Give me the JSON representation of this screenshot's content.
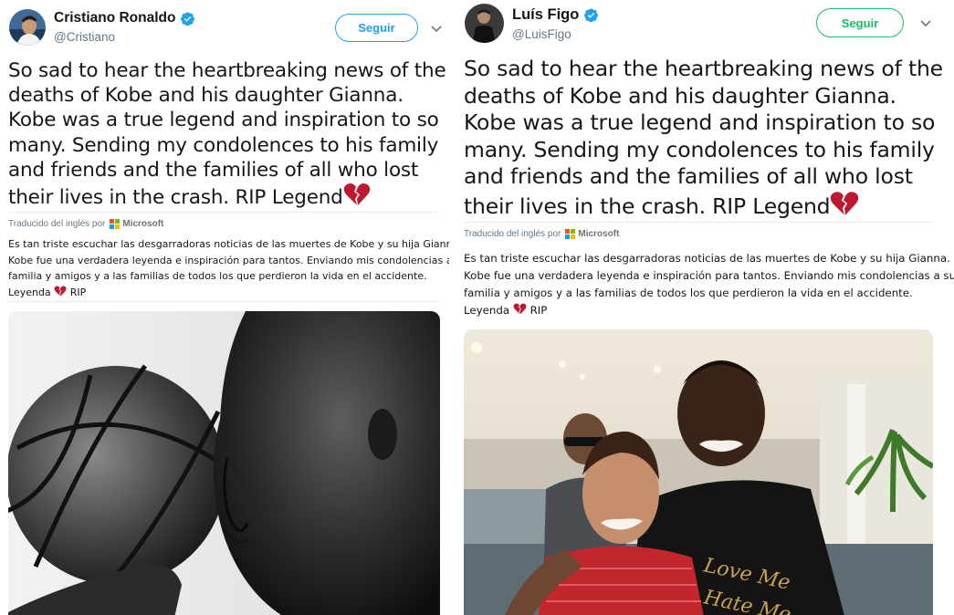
{
  "left_tweet": {
    "name": "Cristiano Ronaldo",
    "handle": "@Cristiano",
    "follow_label": "Seguir",
    "text_lines": [
      "So sad to hear the heartbreaking news of the",
      "deaths of Kobe and his daughter Gianna.",
      "Kobe was a true legend and inspiration to so",
      "many. Sending my condolences to his family",
      "and friends and the families of all who lost",
      "their lives in the crash. RIP Legend"
    ],
    "translated_by": "Traducido del inglés por",
    "translator": "Microsoft",
    "translation_lines": [
      "Es tan triste escuchar las desgarradoras noticias de las muertes de Kobe y su hija Gianna.",
      "Kobe fue una verdadera leyenda e inspiración para tantos. Enviando mis condolencias a su",
      "familia y amigos y a las familias de todos los que perdieron la vida en el accidente.",
      "Leyenda",
      "RIP"
    ],
    "button_color": "#1da1f2",
    "verified_color": "#1da1f2"
  },
  "right_tweet": {
    "name": "Luís Figo",
    "handle": "@LuisFigo",
    "follow_label": "Seguir",
    "text_lines": [
      "So sad to hear the heartbreaking news of the",
      "deaths of Kobe and his daughter Gianna.",
      "Kobe was a true legend and inspiration to so",
      "many. Sending my condolences to his family",
      "and friends and the families of all who lost",
      "their lives in the crash. RIP Legend"
    ],
    "translated_by": "Traducido del inglés por",
    "translator": "Microsoft",
    "translation_lines": [
      "Es tan triste escuchar las desgarradoras noticias de las muertes de Kobe y su hija Gianna.",
      "Kobe fue una verdadera leyenda e inspiración para tantos. Enviando mis condolencias a su",
      "familia y amigos y a las familias de todos los que perdieron la vida en el accidente.",
      "Leyenda",
      "RIP"
    ],
    "button_color": "#17bf63",
    "verified_color": "#1da1f2"
  },
  "icons": {
    "broken_heart": "broken-heart-icon",
    "verified": "verified-badge-icon",
    "chevron": "chevron-down-icon",
    "microsoft": "microsoft-logo-icon"
  },
  "colors": {
    "heart_red": "#be1931",
    "text": "#14171a",
    "muted": "#657786"
  }
}
